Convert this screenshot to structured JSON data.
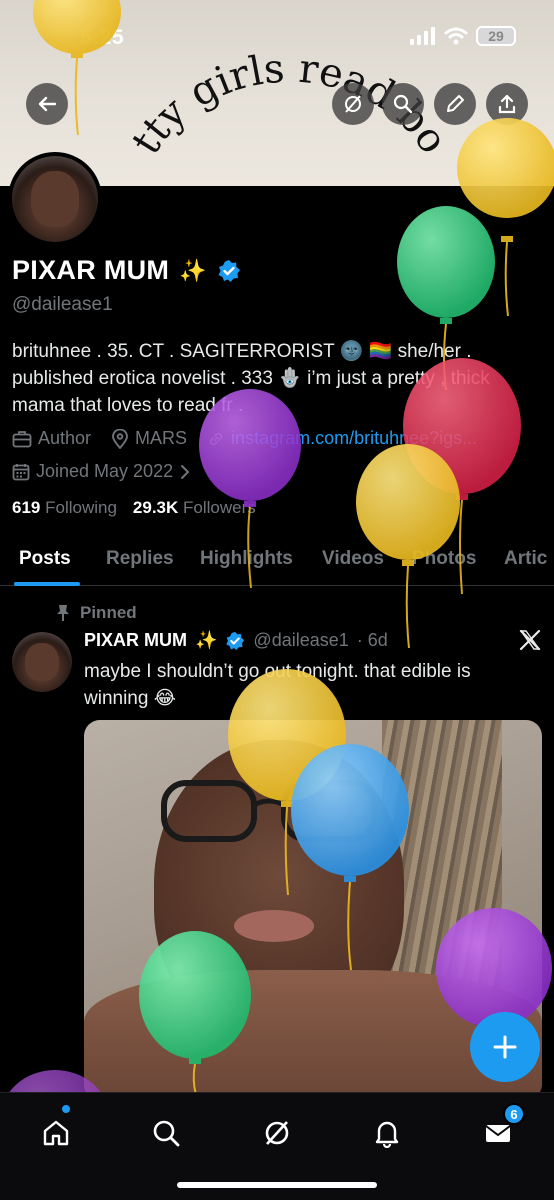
{
  "status_bar": {
    "time": "5:25",
    "battery": "29"
  },
  "banner": {
    "text": "pretty girls read books"
  },
  "profile": {
    "display_name": "PIXAR MUM",
    "sparkle": "✨",
    "handle": "@dailease1",
    "bio": "brituhnee . 35. CT . SAGITERRORIST 🌚 🏳️‍🌈 she/her . published erotica novelist . 333 🪬 i’m just a pretty , thick mama that loves to read fr .",
    "category": "Author",
    "location": "MARS",
    "link": "instagram.com/brituhnee?igs...",
    "joined": "Joined May 2022",
    "following_count": "619",
    "following_label": "Following",
    "followers_count": "29.3K",
    "followers_label": "Followers"
  },
  "tabs": [
    "Posts",
    "Replies",
    "Highlights",
    "Videos",
    "Photos",
    "Artic"
  ],
  "tweet": {
    "pinned_label": "Pinned",
    "name": "PIXAR MUM",
    "sparkle": "✨",
    "handle": "@dailease1",
    "time": "· 6d",
    "text": "maybe I shouldn’t go out tonight. that edible is winning 😂"
  },
  "nav": {
    "messages_badge": "6"
  },
  "colors": {
    "accent": "#1d9bf0",
    "background": "#000000",
    "muted": "#71767b"
  },
  "icons": [
    "back-arrow-icon",
    "grok-icon",
    "search-icon",
    "edit-icon",
    "share-icon",
    "verified-icon",
    "briefcase-icon",
    "location-icon",
    "link-icon",
    "calendar-icon",
    "pin-icon",
    "x-logo-icon",
    "plus-icon",
    "home-icon",
    "bell-icon",
    "mail-icon",
    "balloon-icon"
  ]
}
